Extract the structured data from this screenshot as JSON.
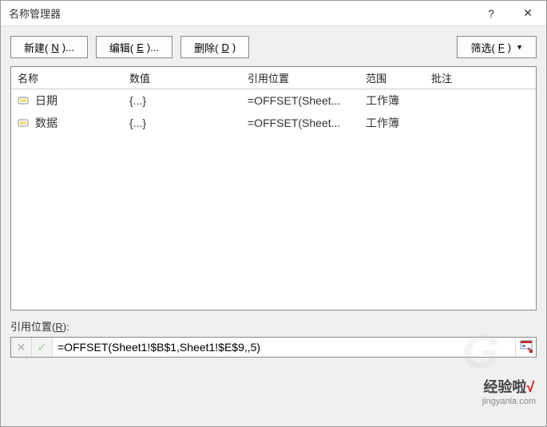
{
  "titlebar": {
    "title": "名称管理器",
    "help": "?",
    "close": "✕"
  },
  "toolbar": {
    "new": {
      "text": "新建(",
      "key": "N",
      "suffix": ")..."
    },
    "edit": {
      "text": "编辑(",
      "key": "E",
      "suffix": ")..."
    },
    "delete": {
      "text": "删除(",
      "key": "D",
      "suffix": ")"
    },
    "filter": {
      "text": "筛选(",
      "key": "F",
      "suffix": ")"
    }
  },
  "columns": {
    "name": "名称",
    "value": "数值",
    "refers": "引用位置",
    "scope": "范围",
    "comment": "批注"
  },
  "rows": [
    {
      "name": "日期",
      "value": "{...}",
      "refers": "=OFFSET(Sheet...",
      "scope": "工作簿"
    },
    {
      "name": "数据",
      "value": "{...}",
      "refers": "=OFFSET(Sheet...",
      "scope": "工作簿"
    }
  ],
  "refers_area": {
    "label_text": "引用位置(",
    "label_key": "R",
    "label_suffix": "):",
    "formula": "=OFFSET(Sheet1!$B$1,Sheet1!$E$9,,5)",
    "cancel": "✕",
    "accept": "✓"
  },
  "watermark": {
    "text": "经验啦",
    "mark": "√",
    "sub": "jingyanla.com"
  }
}
